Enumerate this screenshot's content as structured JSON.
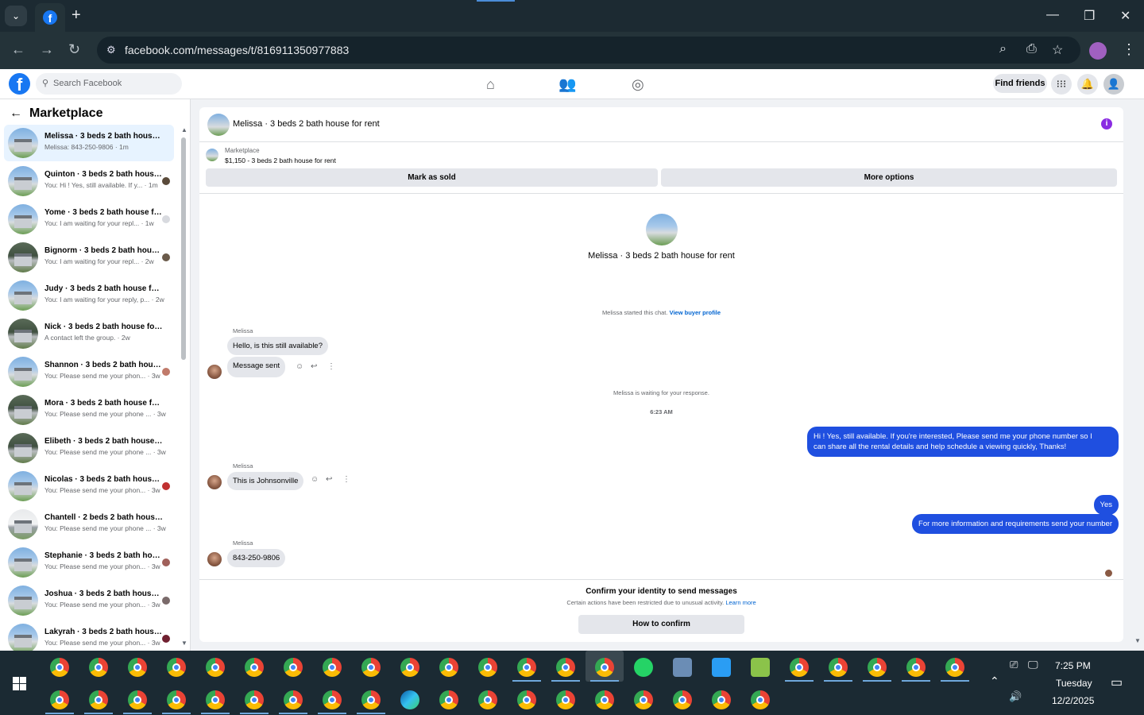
{
  "browser": {
    "url": "facebook.com/messages/t/816911350977883"
  },
  "fb_header": {
    "search_placeholder": "Search Facebook",
    "find_friends": "Find friends"
  },
  "sidebar": {
    "title": "Marketplace",
    "conversations": [
      {
        "title": "Melissa · 3 beds 2 bath house for rent",
        "sub": "Melissa: 843-250-9806 · 1m"
      },
      {
        "title": "Quinton · 3 beds 2 bath house for rent",
        "sub": "You: Hi ! Yes, still available. If y... · 1m"
      },
      {
        "title": "Yome · 3 beds 2 bath house for rent",
        "sub": "You: I am waiting for your repl... · 1w"
      },
      {
        "title": "Bignorm · 3 beds 2 bath house for rent",
        "sub": "You: I am waiting for your repl... · 2w"
      },
      {
        "title": "Judy · 3 beds 2 bath house for rent",
        "sub": "You: I am waiting for your reply, p... · 2w"
      },
      {
        "title": "Nick · 3 beds 2 bath house for rent",
        "sub": "A contact left the group. · 2w"
      },
      {
        "title": "Shannon · 3 beds 2 bath house for rent",
        "sub": "You: Please send me your phon... · 3w"
      },
      {
        "title": "Mora · 3 beds 2 bath house for rent",
        "sub": "You: Please send me your phone ... · 3w"
      },
      {
        "title": "Elibeth · 3 beds 2 bath house for rent",
        "sub": "You: Please send me your phone ... · 3w"
      },
      {
        "title": "Nicolas · 3 beds 2 bath house for rent",
        "sub": "You: Please send me your phon... · 3w"
      },
      {
        "title": "Chantell · 2 beds 2 bath house for rent",
        "sub": "You: Please send me your phone ... · 3w"
      },
      {
        "title": "Stephanie · 3 beds 2 bath house for rent",
        "sub": "You: Please send me your phon... · 3w"
      },
      {
        "title": "Joshua · 3 beds 2 bath house for rent",
        "sub": "You: Please send me your phon... · 3w"
      },
      {
        "title": "Lakyrah · 3 beds 2 bath house for rent",
        "sub": "You: Please send me your phon... · 3w"
      }
    ]
  },
  "chat": {
    "title": "Melissa · 3 beds 2 bath house for rent",
    "marketplace_label": "Marketplace",
    "listing": "$1,150 - 3 beds 2 bath house for rent",
    "mark_sold": "Mark as sold",
    "more_options": "More options",
    "center_title": "Melissa · 3 beds 2 bath house for rent",
    "started": "Melissa started this chat.",
    "view_buyer": "View buyer profile",
    "sender": "Melissa",
    "msg1": "Hello, is this still available?",
    "msg2": "Message sent",
    "waiting": "Melissa is waiting for your response.",
    "time": "6:23 AM",
    "out1_line1": "Hi ! Yes, still available. If you're interested, Please send me your phone number so I",
    "out1_line2": "can share all the rental details and help schedule a viewing quickly, Thanks!",
    "msg3": "This is Johnsonville",
    "out2": "Yes",
    "out3": "For more information and requirements send your number",
    "msg4": "843-250-9806",
    "confirm_title": "Confirm your identity to send messages",
    "confirm_sub": "Certain actions have been restricted due to unusual activity.",
    "learn_more": "Learn more",
    "confirm_btn": "How to confirm"
  },
  "taskbar": {
    "time": "7:25 PM",
    "day": "Tuesday",
    "date": "12/2/2025"
  }
}
